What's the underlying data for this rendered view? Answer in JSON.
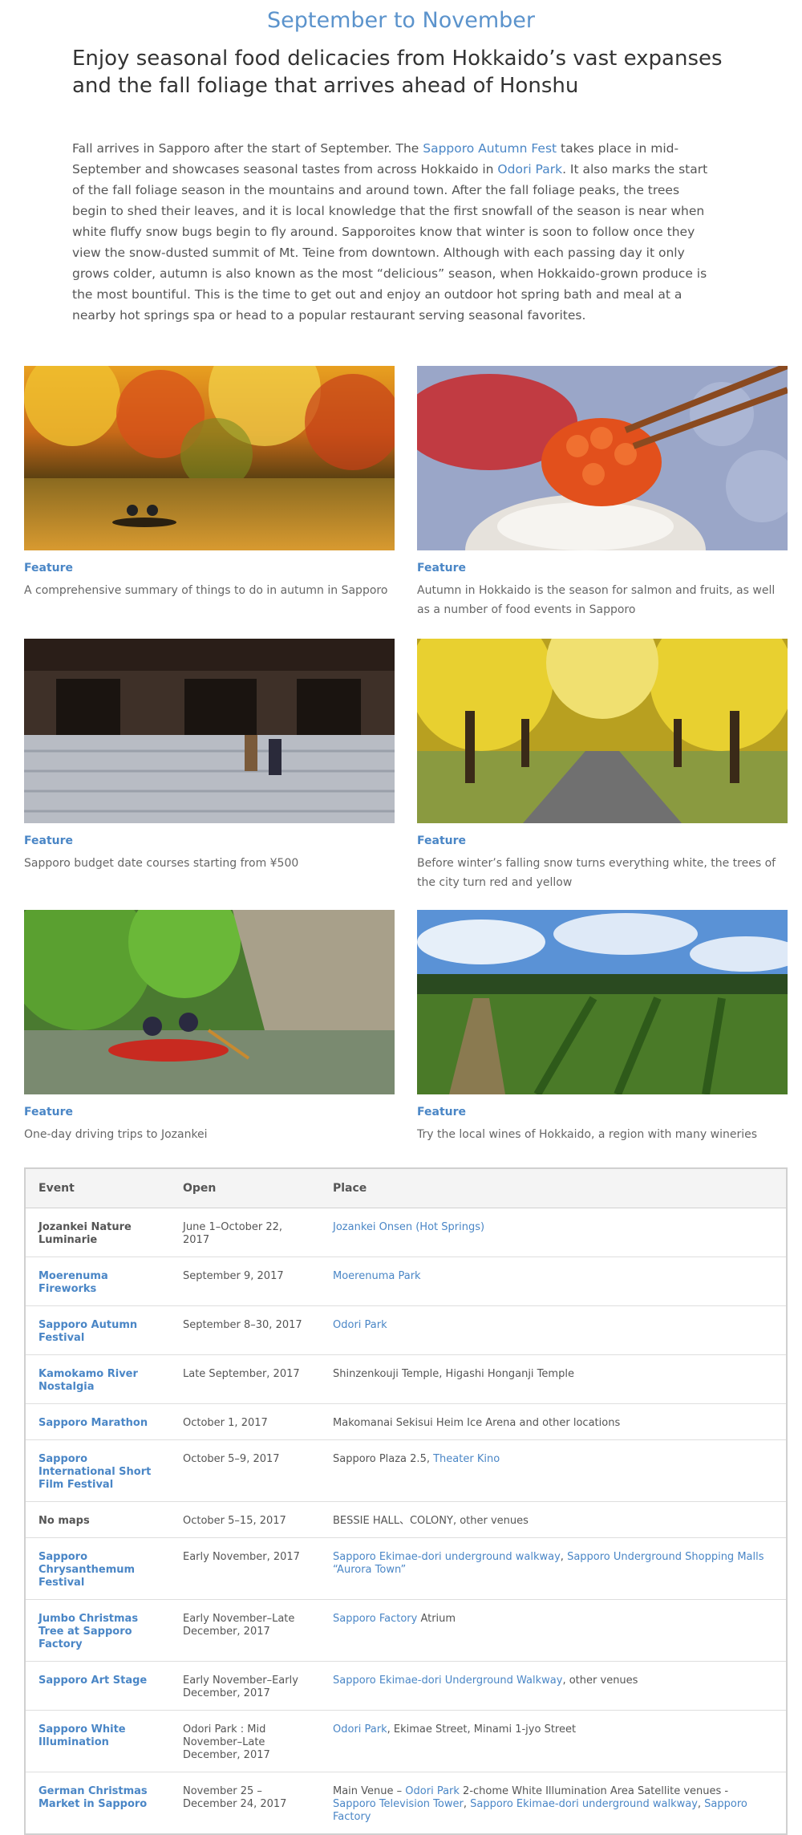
{
  "season_title": "September to November",
  "headline": "Enjoy seasonal food delicacies from Hokkaido’s vast expanses and the fall foliage that arrives ahead of Honshu",
  "intro": {
    "p1": "Fall arrives in Sapporo after the start of September. The ",
    "link1": "Sapporo Autumn Fest",
    "p2": " takes place in mid-September and showcases seasonal tastes from across Hokkaido in ",
    "link2": "Odori Park",
    "p3": ". It also marks the start of the fall foliage season in the mountains and around town. After the fall foliage peaks, the trees begin to shed their leaves, and it is local knowledge that the first snowfall of the season is near when white fluffy snow bugs begin to fly around. Sapporoites know that winter is soon to follow once they view the snow-dusted summit of Mt. Teine from downtown. Although with each passing day it only grows colder, autumn is also known as the most “delicious” season, when Hokkaido-grown produce is the most bountiful. This is the time to get out and enjoy an outdoor hot spring bath and meal at a nearby hot springs spa or head to a popular restaurant serving seasonal favorites."
  },
  "features": [
    {
      "tag": "Feature",
      "desc": "A comprehensive summary of things to do in autumn in Sapporo"
    },
    {
      "tag": "Feature",
      "desc": "Autumn in Hokkaido is the season for salmon and fruits, as well as a number of food events in Sapporo"
    },
    {
      "tag": "Feature",
      "desc": "Sapporo budget date courses starting from ¥500"
    },
    {
      "tag": "Feature",
      "desc": "Before winter’s falling snow turns everything white, the trees of the city turn red and yellow"
    },
    {
      "tag": "Feature",
      "desc": "One-day driving trips to Jozankei"
    },
    {
      "tag": "Feature",
      "desc": "Try the local wines of Hokkaido, a region with many wineries"
    }
  ],
  "events_table": {
    "headers": {
      "event": "Event",
      "open": "Open",
      "place": "Place"
    },
    "rows": [
      {
        "event": "Jozankei Nature Luminarie",
        "event_link": false,
        "open": "June 1–October 22, 2017",
        "place": [
          {
            "t": "Jozankei Onsen (Hot Springs)",
            "link": true
          }
        ]
      },
      {
        "event": "Moerenuma Fireworks",
        "event_link": true,
        "open": "September 9, 2017",
        "place": [
          {
            "t": "Moerenuma Park",
            "link": true
          }
        ]
      },
      {
        "event": "Sapporo Autumn Festival",
        "event_link": true,
        "open": "September 8–30, 2017",
        "place": [
          {
            "t": "Odori Park",
            "link": true
          }
        ]
      },
      {
        "event": "Kamokamo River Nostalgia",
        "event_link": true,
        "open": "Late September, 2017",
        "place": [
          {
            "t": "Shinzenkouji Temple, Higashi Honganji Temple",
            "link": false
          }
        ]
      },
      {
        "event": "Sapporo Marathon",
        "event_link": true,
        "open": "October 1, 2017",
        "place": [
          {
            "t": "Makomanai Sekisui Heim Ice Arena and other locations",
            "link": false
          }
        ]
      },
      {
        "event": "Sapporo International Short Film Festival",
        "event_link": true,
        "open": "October 5–9, 2017",
        "place": [
          {
            "t": "Sapporo Plaza 2.5, ",
            "link": false
          },
          {
            "t": "Theater Kino",
            "link": true
          }
        ]
      },
      {
        "event": "No maps",
        "event_link": false,
        "open": "October 5–15, 2017",
        "place": [
          {
            "t": "BESSIE HALL、COLONY, other venues",
            "link": false
          }
        ]
      },
      {
        "event": "Sapporo Chrysanthemum Festival",
        "event_link": true,
        "open": "Early November, 2017",
        "place": [
          {
            "t": "Sapporo Ekimae-dori underground walkway",
            "link": true
          },
          {
            "t": ", ",
            "link": false
          },
          {
            "t": "Sapporo Underground Shopping Malls “Aurora Town”",
            "link": true
          }
        ]
      },
      {
        "event": "Jumbo Christmas Tree at Sapporo Factory",
        "event_link": true,
        "open": "Early November–Late December, 2017",
        "place": [
          {
            "t": "Sapporo Factory",
            "link": true
          },
          {
            "t": " Atrium",
            "link": false
          }
        ]
      },
      {
        "event": "Sapporo Art Stage",
        "event_link": true,
        "open": "Early November–Early December, 2017",
        "place": [
          {
            "t": "Sapporo Ekimae-dori Underground Walkway",
            "link": true
          },
          {
            "t": ", other venues",
            "link": false
          }
        ]
      },
      {
        "event": "Sapporo White Illumination",
        "event_link": true,
        "open": "Odori Park : Mid November–Late December, 2017",
        "place": [
          {
            "t": "Odori Park",
            "link": true
          },
          {
            "t": ", Ekimae Street, Minami 1-jyo Street",
            "link": false
          }
        ]
      },
      {
        "event": "German Christmas Market in Sapporo",
        "event_link": true,
        "open": "November 25 – December 24, 2017",
        "place": [
          {
            "t": "Main Venue – ",
            "link": false
          },
          {
            "t": "Odori Park",
            "link": true
          },
          {
            "t": " 2-chome White Illumination Area Satellite venues - ",
            "link": false
          },
          {
            "t": "Sapporo Television Tower",
            "link": true
          },
          {
            "t": ", ",
            "link": false
          },
          {
            "t": "Sapporo Ekimae-dori underground walkway",
            "link": true
          },
          {
            "t": ", ",
            "link": false
          },
          {
            "t": "Sapporo Factory",
            "link": true
          }
        ]
      }
    ]
  },
  "colors": {
    "accent": "#4a86c6",
    "title_blue": "#5b93cc",
    "table_header_bg": "#f4f4f4",
    "border": "#d0d0d0"
  }
}
